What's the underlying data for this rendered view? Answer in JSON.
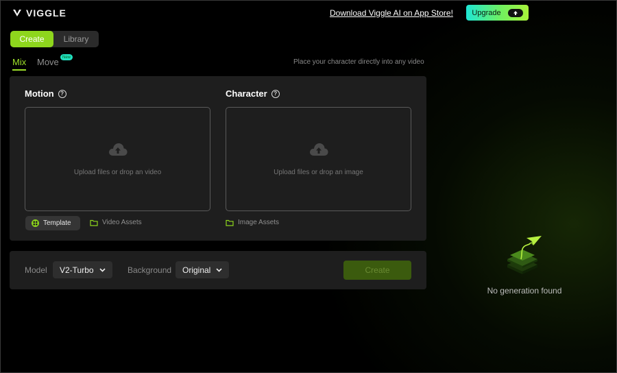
{
  "header": {
    "logo_text": "VIGGLE",
    "download_link": "Download Viggle AI on App Store!",
    "upgrade_label": "Upgrade"
  },
  "mode_toggle": {
    "create": "Create",
    "library": "Library"
  },
  "tabs": {
    "mix": "Mix",
    "move": "Move",
    "new_badge": "New",
    "hint": "Place your character directly into any video"
  },
  "motion": {
    "title": "Motion",
    "dropzone_text": "Upload files or drop an video",
    "template_label": "Template",
    "assets_label": "Video Assets"
  },
  "character": {
    "title": "Character",
    "dropzone_text": "Upload files or drop an image",
    "assets_label": "Image Assets"
  },
  "settings": {
    "model_label": "Model",
    "model_value": "V2-Turbo",
    "background_label": "Background",
    "background_value": "Original",
    "create_label": "Create"
  },
  "empty_state": {
    "text": "No generation found"
  },
  "colors": {
    "accent": "#8ed61d",
    "panel": "#1e1e1e",
    "background": "#000000"
  }
}
